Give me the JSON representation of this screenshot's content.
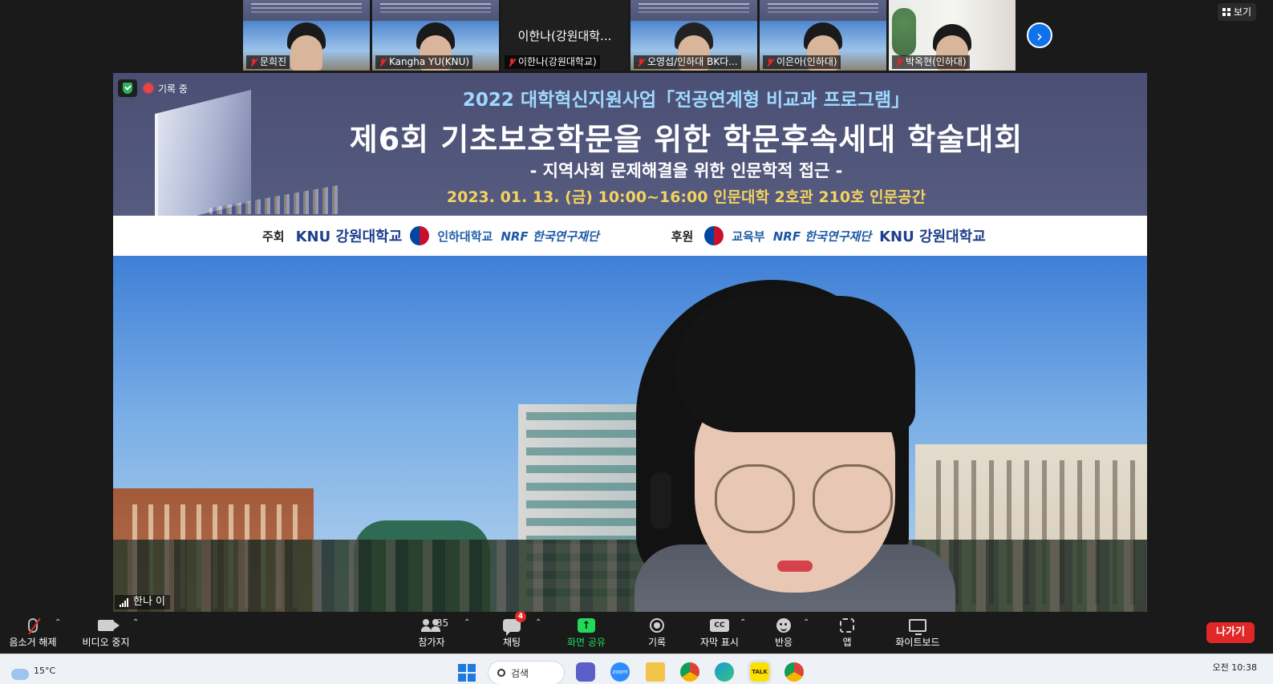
{
  "gallery": {
    "tiles": [
      {
        "name": "문희진"
      },
      {
        "name": "Kangha YU(KNU)"
      },
      {
        "name": "이한나(강원대학교)",
        "center_name": "이한나(강원대학..."
      },
      {
        "name": "오영섭/인하대 BK다..."
      },
      {
        "name": "이은아(인하대)"
      },
      {
        "name": "박옥현(인하대)"
      }
    ],
    "next_icon": "chevron-right-icon"
  },
  "view_button": {
    "label": "보기"
  },
  "main_video": {
    "recording_label": "기록 중",
    "speaker_name": "한나 이",
    "banner": {
      "line1": "2022 대학혁신지원사업「전공연계형 비교과 프로그램」",
      "line2": "제6회 기초보호학문을 위한 학문후속세대 학술대회",
      "line3": "- 지역사회 문제해결을 위한 인문학적 접근 -",
      "line4": "2023. 01. 13. (금) 10:00~16:00 인문대학 2호관 210호 인문공간"
    },
    "sponsors": {
      "host_label": "주회",
      "host_logos": [
        "KNU 강원대학교",
        "인하대학교",
        "NRF 한국연구재단"
      ],
      "support_label": "후원",
      "support_logos": [
        "교육부",
        "NRF 한국연구재단",
        "KNU 강원대학교"
      ]
    }
  },
  "toolbar": {
    "mute_label": "음소거 해제",
    "video_label": "비디오 중지",
    "participants_label": "참가자",
    "participants_count": "35",
    "chat_label": "채팅",
    "chat_badge": "4",
    "share_label": "화면 공유",
    "record_label": "기록",
    "cc_label": "자막 표시",
    "cc_icon_text": "CC",
    "reactions_label": "반응",
    "apps_label": "앱",
    "whiteboard_label": "화이트보드",
    "leave_label": "나가기"
  },
  "taskbar": {
    "temperature": "15°C",
    "search_label": "검색",
    "zoom_icon_text": "zoom",
    "kakao_icon_text": "TALK",
    "clock_time": "오전 10:38"
  },
  "colors": {
    "accent_blue": "#0e72ed",
    "share_green": "#23d959",
    "leave_red": "#e02828",
    "banner_bg": "#4a4f73"
  }
}
